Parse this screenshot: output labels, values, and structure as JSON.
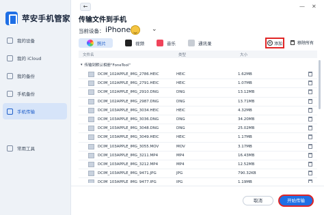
{
  "app": {
    "name": "苹安手机管家"
  },
  "sidebar": {
    "items": [
      {
        "label": "我的设备",
        "active": false
      },
      {
        "label": "我的 iCloud",
        "active": false
      },
      {
        "label": "我的备份",
        "active": false
      },
      {
        "label": "手机备份",
        "active": false
      },
      {
        "label": "手机传输",
        "active": true
      },
      {
        "label": "常用工具",
        "active": false
      }
    ]
  },
  "header": {
    "back_glyph": "←",
    "title": "传输文件到手机",
    "minimize_glyph": "—",
    "close_glyph": "✕",
    "device_label": "当前设备：",
    "device_name": "iPhone11",
    "dropdown_glyph": "⌄"
  },
  "tabs": [
    {
      "label": "照片",
      "icon": "photos-icon",
      "active": true
    },
    {
      "label": "视频",
      "icon": "video-icon",
      "active": false
    },
    {
      "label": "音乐",
      "icon": "music-icon",
      "active": false
    },
    {
      "label": "通讯录",
      "icon": "contacts-icon",
      "active": false
    }
  ],
  "actions": {
    "add_label": "添加",
    "add_glyph": "+",
    "remove_all_label": "移除所有"
  },
  "table": {
    "columns": {
      "name": "文件名",
      "type": "类型",
      "size": "大小"
    },
    "group_label": "传输到默认相册\"FoneTool\"",
    "group_caret": "▾",
    "rows": [
      {
        "name": "DCIM_102APPLE_IMG_2786.HEIC",
        "type": "HEIC",
        "size": "1.62MB"
      },
      {
        "name": "DCIM_102APPLE_IMG_2791.HEIC",
        "type": "HEIC",
        "size": "1.07MB"
      },
      {
        "name": "DCIM_102APPLE_IMG_2910.DNG",
        "type": "DNG",
        "size": "13.12MB"
      },
      {
        "name": "DCIM_102APPLE_IMG_2987.DNG",
        "type": "DNG",
        "size": "13.71MB"
      },
      {
        "name": "DCIM_103APPLE_IMG_3034.HEIC",
        "type": "HEIC",
        "size": "4.32MB"
      },
      {
        "name": "DCIM_103APPLE_IMG_3036.DNG",
        "type": "DNG",
        "size": "34.20MB"
      },
      {
        "name": "DCIM_103APPLE_IMG_3048.DNG",
        "type": "DNG",
        "size": "25.02MB"
      },
      {
        "name": "DCIM_103APPLE_IMG_3049.HEIC",
        "type": "HEIC",
        "size": "1.17MB"
      },
      {
        "name": "DCIM_103APPLE_IMG_3055.MOV",
        "type": "MOV",
        "size": "3.17MB"
      },
      {
        "name": "DCIM_103APPLE_IMG_3211.MP4",
        "type": "MP4",
        "size": "16.43MB"
      },
      {
        "name": "DCIM_103APPLE_IMG_3212.MP4",
        "type": "MP4",
        "size": "12.52MB"
      },
      {
        "name": "DCIM_103APPLE_IMG_9471.JPG",
        "type": "JPG",
        "size": "790.32KB"
      },
      {
        "name": "DCIM_103APPLE_IMG_9477.JPG",
        "type": "JPG",
        "size": "1.19MB"
      }
    ]
  },
  "footer": {
    "cancel_label": "取消",
    "start_label": "开始传输"
  },
  "colors": {
    "accent": "#1f6fe5",
    "highlight_border": "#e02424",
    "sidebar_bg": "#eef2f7"
  }
}
